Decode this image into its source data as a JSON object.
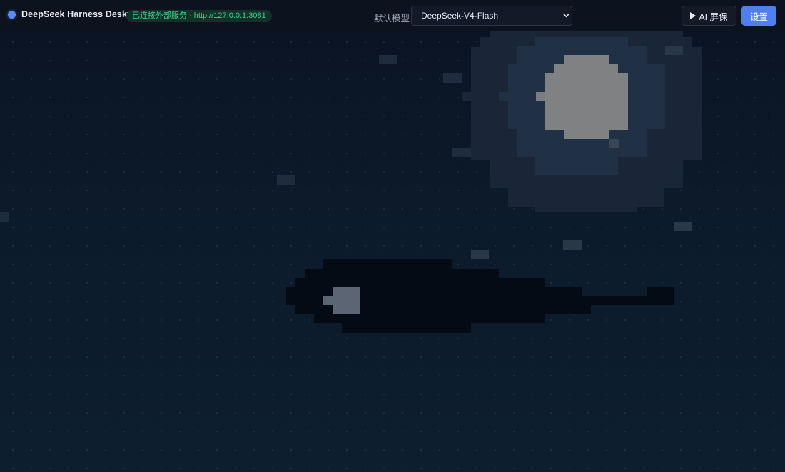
{
  "header": {
    "app_title": "DeepSeek Harness Desktop",
    "status": "已连接外部服务 · http://127.0.0.1:3081",
    "model_label": "默认模型",
    "model_value": "DeepSeek-V4-Flash",
    "screensaver_label": "AI 屏保",
    "settings_label": "设置"
  },
  "icons": {
    "status_dot": "status-dot-icon",
    "select_chevron": "chevron-down-icon",
    "play": "play-icon"
  },
  "colors": {
    "accent": "#4f7ff0",
    "status_text": "#3ecf8e",
    "status_bg": "#123128",
    "background": "#0b1422",
    "moon": "#808183"
  }
}
